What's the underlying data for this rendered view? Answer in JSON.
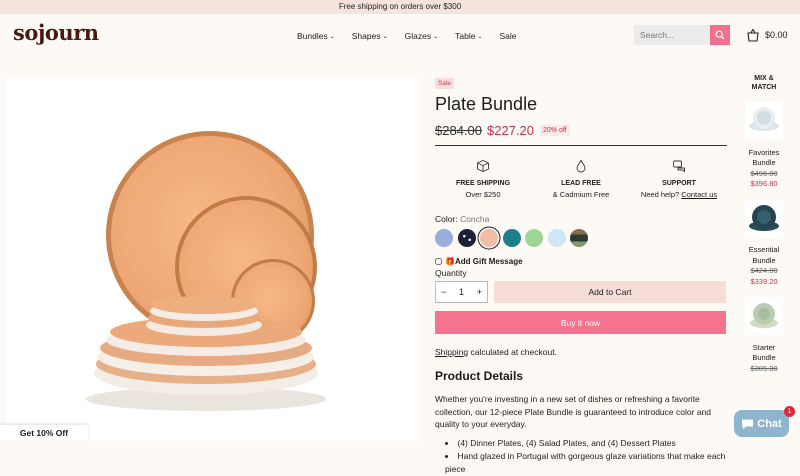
{
  "announcement": "Free shipping on orders over $300",
  "brand": "sojourn",
  "nav": [
    {
      "label": "Bundles",
      "has_dropdown": true
    },
    {
      "label": "Shapes",
      "has_dropdown": true
    },
    {
      "label": "Glazes",
      "has_dropdown": true
    },
    {
      "label": "Table",
      "has_dropdown": true
    },
    {
      "label": "Sale",
      "has_dropdown": false
    }
  ],
  "search": {
    "placeholder": "Search...",
    "icon": "search-icon"
  },
  "cart": {
    "total": "$0.00",
    "icon": "bag-icon"
  },
  "product": {
    "badge": "Sale",
    "title": "Plate Bundle",
    "old_price": "$284.00",
    "new_price": "$227.20",
    "discount": "20% off",
    "features": [
      {
        "icon": "box-icon",
        "heading": "FREE SHIPPING",
        "text": "Over $250"
      },
      {
        "icon": "drop-icon",
        "heading": "LEAD FREE",
        "text": "& Cadmium Free"
      },
      {
        "icon": "support-icon",
        "heading": "SUPPORT",
        "text": "Need help?",
        "link": "Contact us"
      }
    ],
    "color_label": "Color:",
    "color_value": "Concha",
    "swatches": [
      {
        "name": "blue-lavender",
        "color": "#9aaedb"
      },
      {
        "name": "speckled-navy",
        "color": "#1b2036"
      },
      {
        "name": "concha",
        "color": "#f3bca6",
        "selected": true
      },
      {
        "name": "teal",
        "color": "#1f7f8a"
      },
      {
        "name": "mint",
        "color": "#9ed69a"
      },
      {
        "name": "sky",
        "color": "#cfe6f6"
      },
      {
        "name": "earth",
        "color": "#5a6a4e"
      }
    ],
    "gift_label": "Add Gift Message",
    "quantity_label": "Quantity",
    "quantity": "1",
    "add_to_cart": "Add to Cart",
    "buy_now": "Buy it now",
    "shipping_link": "Shipping",
    "shipping_text": " calculated at checkout.",
    "details_title": "Product Details",
    "details_text": "Whether you're investing in a new set of dishes or refreshing a favorite collection, our 12-piece Plate Bundle is guaranteed to introduce color and quality to your everyday.",
    "details_list": [
      "(4) Dinner Plates, (4) Salad Plates, and (4) Dessert Plates",
      "Hand glazed in Portugal with gorgeous glaze variations that make each piece"
    ]
  },
  "mix_match": {
    "title": "MIX & MATCH",
    "items": [
      {
        "name": "Favorites Bundle",
        "old_price": "$496.00",
        "new_price": "$396.80"
      },
      {
        "name": "Essential Bundle",
        "old_price": "$424.00",
        "new_price": "$339.20"
      },
      {
        "name": "Starter Bundle",
        "old_price": "$305.00",
        "new_price": ""
      }
    ]
  },
  "promo": "Get 10% Off",
  "chat": {
    "label": "Chat",
    "badge": "1"
  },
  "colors": {
    "accent": "#f4738f",
    "sale": "#c8324b",
    "brand": "#4a1a12"
  }
}
